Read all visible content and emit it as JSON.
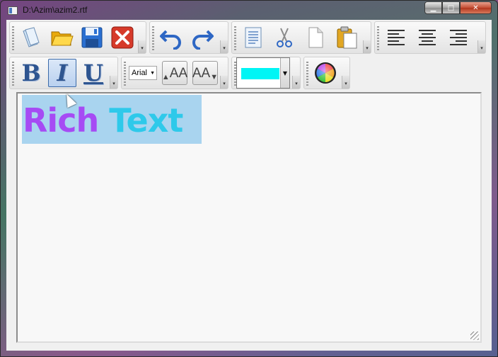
{
  "window": {
    "title": "D:\\Azim\\azim2.rtf",
    "controls": {
      "minimize": "▁",
      "maximize": "□",
      "close": "✕"
    }
  },
  "toolbar_file": {
    "new": {
      "icon": "new-document-icon"
    },
    "open": {
      "icon": "open-folder-icon"
    },
    "save": {
      "icon": "save-floppy-icon"
    },
    "close": {
      "icon": "close-x-icon"
    },
    "overflow": "▾"
  },
  "toolbar_history": {
    "undo": {
      "icon": "undo-arrow-icon"
    },
    "redo": {
      "icon": "redo-arrow-icon"
    },
    "overflow": "▾"
  },
  "toolbar_clipboard": {
    "select_all": {
      "icon": "select-document-icon"
    },
    "cut": {
      "icon": "scissors-icon"
    },
    "copy": {
      "icon": "copy-page-icon"
    },
    "paste": {
      "icon": "paste-clipboard-icon"
    },
    "overflow": "▾"
  },
  "toolbar_align": {
    "left": {
      "icon": "align-left-icon"
    },
    "center": {
      "icon": "align-center-icon"
    },
    "right": {
      "icon": "align-right-icon"
    },
    "overflow": "▾"
  },
  "toolbar_format": {
    "bold": "B",
    "italic": "I",
    "underline": "U",
    "italic_active": true,
    "overflow": "▾"
  },
  "toolbar_font": {
    "font_name": "Arial",
    "grow_label": "AA",
    "shrink_label": "AA",
    "overflow": "▾"
  },
  "toolbar_color": {
    "current_color": "#00f5f5",
    "dropdown": "▼",
    "overflow": "▾"
  },
  "toolbar_palette": {
    "icon": "color-wheel-icon",
    "overflow": "▾"
  },
  "editor": {
    "word1": "Rich",
    "word2": "Text",
    "word1_color": "#a64bf4",
    "word2_color": "#2ec9ea",
    "selection_color": "#a9d4ef"
  }
}
